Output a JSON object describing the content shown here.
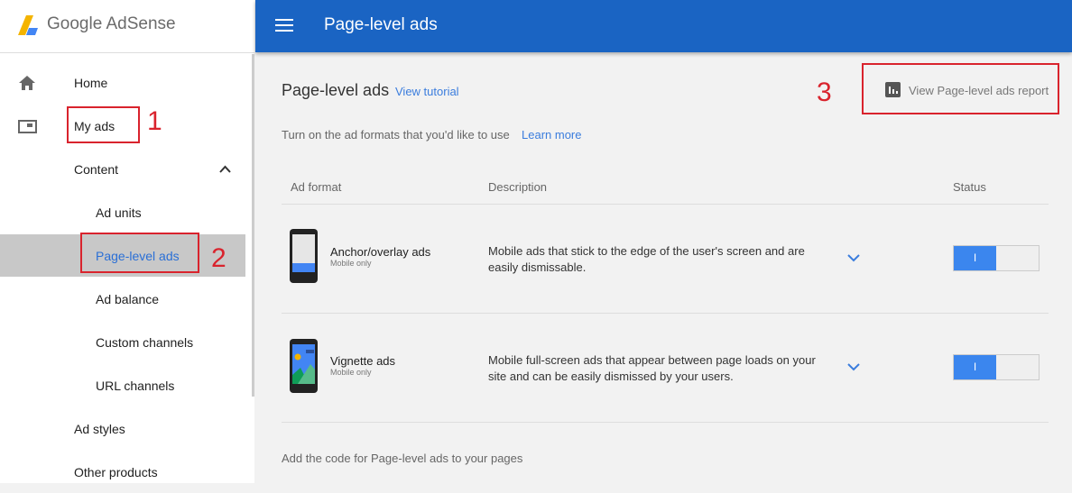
{
  "app": {
    "logo_text": "Google AdSense",
    "page_title": "Page-level ads"
  },
  "sidebar": {
    "items": [
      {
        "label": "Home",
        "icon": "home-icon"
      },
      {
        "label": "My ads",
        "icon": "ads-icon"
      },
      {
        "label": "Content"
      },
      {
        "label": "Ad units"
      },
      {
        "label": "Page-level ads",
        "selected": true
      },
      {
        "label": "Ad balance"
      },
      {
        "label": "Custom channels"
      },
      {
        "label": "URL channels"
      },
      {
        "label": "Ad styles"
      },
      {
        "label": "Other products"
      }
    ]
  },
  "annotations": [
    "1",
    "2",
    "3"
  ],
  "main": {
    "title": "Page-level ads",
    "tutorial_link": "View tutorial",
    "report_link": "View Page-level ads report",
    "instruction": "Turn on the ad formats that you'd like to use",
    "learn_more": "Learn more",
    "columns": [
      "Ad format",
      "Description",
      "Status"
    ],
    "rows": [
      {
        "name": "Anchor/overlay ads",
        "sub": "Mobile only",
        "desc": "Mobile ads that stick to the edge of the user's screen and are easily dismissable.",
        "status": "on",
        "toggle_label": "I"
      },
      {
        "name": "Vignette ads",
        "sub": "Mobile only",
        "desc": "Mobile full-screen ads that appear between page loads on your site and can be easily dismissed by your users.",
        "status": "on",
        "toggle_label": "I"
      }
    ],
    "footer": "Add the code for Page-level ads to your pages"
  },
  "colors": {
    "header": "#1a64c3",
    "accent": "#3b86ee",
    "annotation": "#d9232d",
    "selected": "#c8c8c8"
  }
}
